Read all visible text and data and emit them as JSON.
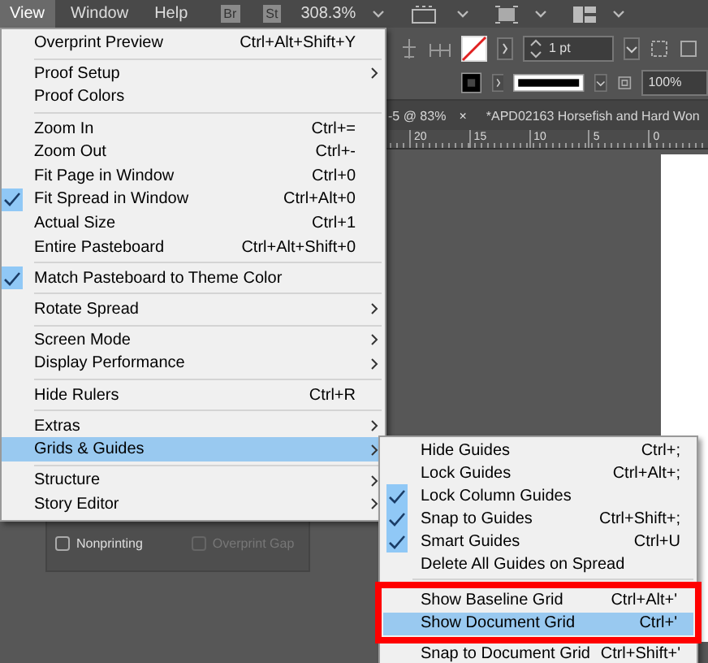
{
  "menu_bar": {
    "items": [
      {
        "label": "View",
        "selected": true
      },
      {
        "label": "Window",
        "selected": false
      },
      {
        "label": "Help",
        "selected": false
      }
    ],
    "badges": [
      "Br",
      "St"
    ],
    "zoom": "308.3%"
  },
  "control_panel": {
    "stroke_weight": "1 pt",
    "opacity": "100%"
  },
  "document_tabs": [
    {
      "label": "-5 @ 83%",
      "close": "×"
    },
    {
      "label": "*APD02163 Horsefish and Hard Won"
    }
  ],
  "ruler": {
    "ticks": [
      "20",
      "15",
      "10",
      "5",
      "0"
    ]
  },
  "attributes_panel": {
    "checkboxes": [
      {
        "label": "Nonprinting",
        "checked": false,
        "disabled": false
      },
      {
        "label": "Overprint Gap",
        "checked": false,
        "disabled": true
      }
    ]
  },
  "view_menu": {
    "items": [
      {
        "kind": "item",
        "label": "Overprint Preview",
        "shortcut": "Ctrl+Alt+Shift+Y",
        "checked": false,
        "submenu": false,
        "selected": false
      },
      {
        "kind": "separator"
      },
      {
        "kind": "item",
        "label": "Proof Setup",
        "checked": false,
        "submenu": true,
        "selected": false
      },
      {
        "kind": "item",
        "label": "Proof Colors",
        "checked": false,
        "submenu": false,
        "selected": false
      },
      {
        "kind": "separator"
      },
      {
        "kind": "item",
        "label": "Zoom In",
        "shortcut": "Ctrl+=",
        "checked": false,
        "submenu": false,
        "selected": false
      },
      {
        "kind": "item",
        "label": "Zoom Out",
        "shortcut": "Ctrl+-",
        "checked": false,
        "submenu": false,
        "selected": false
      },
      {
        "kind": "item",
        "label": "Fit Page in Window",
        "shortcut": "Ctrl+0",
        "checked": false,
        "submenu": false,
        "selected": false
      },
      {
        "kind": "item",
        "label": "Fit Spread in Window",
        "shortcut": "Ctrl+Alt+0",
        "checked": true,
        "submenu": false,
        "selected": false
      },
      {
        "kind": "item",
        "label": "Actual Size",
        "shortcut": "Ctrl+1",
        "checked": false,
        "submenu": false,
        "selected": false
      },
      {
        "kind": "item",
        "label": "Entire Pasteboard",
        "shortcut": "Ctrl+Alt+Shift+0",
        "checked": false,
        "submenu": false,
        "selected": false
      },
      {
        "kind": "separator"
      },
      {
        "kind": "item",
        "label": "Match Pasteboard to Theme Color",
        "checked": true,
        "submenu": false,
        "selected": false
      },
      {
        "kind": "separator"
      },
      {
        "kind": "item",
        "label": "Rotate Spread",
        "checked": false,
        "submenu": true,
        "selected": false
      },
      {
        "kind": "separator"
      },
      {
        "kind": "item",
        "label": "Screen Mode",
        "checked": false,
        "submenu": true,
        "selected": false
      },
      {
        "kind": "item",
        "label": "Display Performance",
        "checked": false,
        "submenu": true,
        "selected": false
      },
      {
        "kind": "separator"
      },
      {
        "kind": "item",
        "label": "Hide Rulers",
        "shortcut": "Ctrl+R",
        "checked": false,
        "submenu": false,
        "selected": false
      },
      {
        "kind": "separator"
      },
      {
        "kind": "item",
        "label": "Extras",
        "checked": false,
        "submenu": true,
        "selected": false
      },
      {
        "kind": "item",
        "label": "Grids & Guides",
        "checked": false,
        "submenu": true,
        "selected": true
      },
      {
        "kind": "separator"
      },
      {
        "kind": "item",
        "label": "Structure",
        "checked": false,
        "submenu": true,
        "selected": false
      },
      {
        "kind": "item",
        "label": "Story Editor",
        "checked": false,
        "submenu": true,
        "selected": false
      }
    ]
  },
  "grids_submenu": {
    "items": [
      {
        "kind": "item",
        "label": "Hide Guides",
        "shortcut": "Ctrl+;",
        "checked": false,
        "selected": false,
        "annotated": false
      },
      {
        "kind": "item",
        "label": "Lock Guides",
        "shortcut": "Ctrl+Alt+;",
        "checked": false,
        "selected": false,
        "annotated": false
      },
      {
        "kind": "item",
        "label": "Lock Column Guides",
        "checked": true,
        "selected": false,
        "annotated": false
      },
      {
        "kind": "item",
        "label": "Snap to Guides",
        "shortcut": "Ctrl+Shift+;",
        "checked": true,
        "selected": false,
        "annotated": false
      },
      {
        "kind": "item",
        "label": "Smart Guides",
        "shortcut": "Ctrl+U",
        "checked": true,
        "selected": false,
        "annotated": false
      },
      {
        "kind": "item",
        "label": "Delete All Guides on Spread",
        "checked": false,
        "selected": false,
        "annotated": false
      },
      {
        "kind": "separator"
      },
      {
        "kind": "item",
        "label": "Show Baseline Grid",
        "shortcut": "Ctrl+Alt+'",
        "checked": false,
        "selected": false,
        "annotated": true
      },
      {
        "kind": "item",
        "label": "Show Document Grid",
        "shortcut": "Ctrl+'",
        "checked": false,
        "selected": true,
        "annotated": true
      },
      {
        "kind": "item",
        "label": "Snap to Document Grid",
        "shortcut": "Ctrl+Shift+'",
        "checked": false,
        "selected": false,
        "annotated": false
      }
    ]
  }
}
